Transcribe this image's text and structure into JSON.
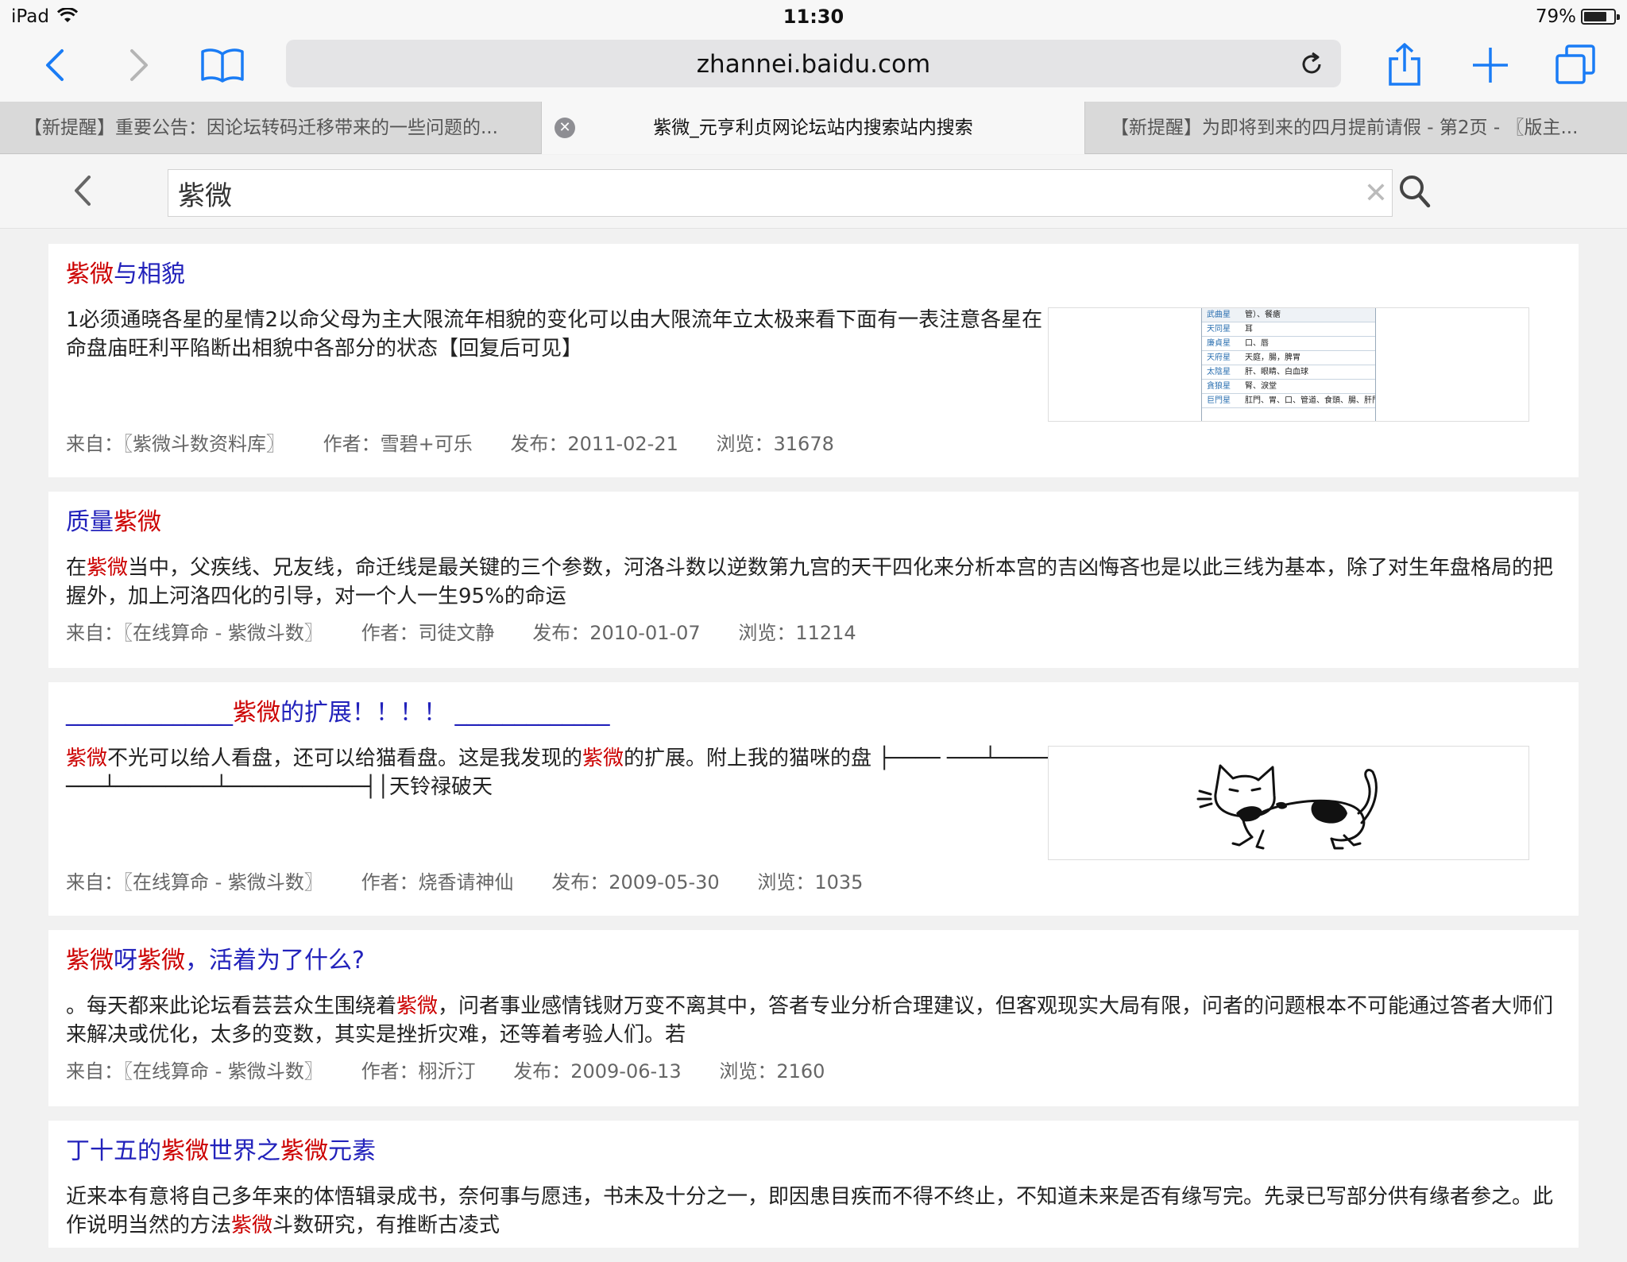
{
  "status": {
    "device": "iPad",
    "time": "11:30",
    "battery": "79%",
    "battery_level": 0.79
  },
  "browser": {
    "url": "zhannei.baidu.com",
    "tabs": [
      {
        "label": "【新提醒】重要公告：因论坛转码迁移带来的一些问题的..."
      },
      {
        "label": "紫微_元亨利贞网论坛站内搜索站内搜索",
        "active": true
      },
      {
        "label": "【新提醒】为即将到来的四月提前请假 - 第2页 - 〖版主..."
      }
    ]
  },
  "search": {
    "query": "紫微"
  },
  "results": [
    {
      "title": [
        {
          "t": "紫微",
          "hl": true
        },
        {
          "t": "与相貌",
          "hl": false
        }
      ],
      "body": [
        {
          "t": "1必须通晓各星的星情2以命父母为主大限流年相貌的变化可以由大限流年立太极来看下面有一表注意各星在命盘庙旺利平陷断出相貌中各部分的状态【回复后可见】",
          "hl": false
        }
      ],
      "source": "来自：〖紫微斗数资料库〗",
      "author": "作者：雪碧+可乐",
      "date": "发布：2011-02-21",
      "views": "浏览：31678",
      "thumbnail": {
        "rows": [
          {
            "star": "武曲星",
            "parts": "管）、餐瘡"
          },
          {
            "star": "天同星",
            "parts": "耳"
          },
          {
            "star": "廉貞星",
            "parts": "口、唇"
          },
          {
            "star": "天府星",
            "parts": "天庭，腸，脾胃"
          },
          {
            "star": "太陰星",
            "parts": "肝、眼睛、白血球"
          },
          {
            "star": "貪狼星",
            "parts": "腎、淚堂"
          },
          {
            "star": "巨門星",
            "parts": "肛門、胃、口、管道、食頭、腸、肝門"
          }
        ]
      }
    },
    {
      "title": [
        {
          "t": "质量",
          "hl": false
        },
        {
          "t": "紫微",
          "hl": true
        }
      ],
      "body": [
        {
          "t": "在",
          "hl": false
        },
        {
          "t": "紫微",
          "hl": true
        },
        {
          "t": "当中，父疾线、兄友线，命迁线是最关键的三个参数，河洛斗数以逆数第九宫的天干四化来分析本宫的吉凶悔吝也是以此三线为基本，除了对生年盘格局的把握外，加上河洛四化的引导，对一个人一生95%的命运",
          "hl": false
        }
      ],
      "source": "来自：〖在线算命 - 紫微斗数〗",
      "author": "作者：司徒文静",
      "date": "发布：2010-01-07",
      "views": "浏览：11214"
    },
    {
      "title": [
        {
          "t": "______________",
          "hl": false
        },
        {
          "t": "紫微",
          "hl": true
        },
        {
          "t": "的扩展！！！！ _____________",
          "hl": false
        }
      ],
      "body": [
        {
          "t": "紫微",
          "hl": true
        },
        {
          "t": "不光可以给人看盘，还可以给猫看盘。这是我发现的",
          "hl": false
        },
        {
          "t": "紫微",
          "hl": true
        },
        {
          "t": "的扩展。附上我的猫咪的盘 ├──── ───┴────────┴────────┴───────────┤│天铃禄破天",
          "hl": false
        }
      ],
      "source": "来自：〖在线算命 - 紫微斗数〗",
      "author": "作者：烧香请神仙",
      "date": "发布：2009-05-30",
      "views": "浏览：1035",
      "thumbnail": {
        "picture": "cat-drawing"
      }
    },
    {
      "title": [
        {
          "t": "紫微",
          "hl": true
        },
        {
          "t": "呀",
          "hl": false
        },
        {
          "t": "紫微",
          "hl": true
        },
        {
          "t": "，活着为了什么?",
          "hl": false
        }
      ],
      "body": [
        {
          "t": "。每天都来此论坛看芸芸众生围绕着",
          "hl": false
        },
        {
          "t": "紫微",
          "hl": true
        },
        {
          "t": "，问者事业感情钱财万变不离其中，答者专业分析合理建议，但客观现实大局有限，问者的问题根本不可能通过答者大师们来解决或优化，太多的变数，其实是挫折灾难，还等着考验人们。若",
          "hl": false
        }
      ],
      "source": "来自：〖在线算命 - 紫微斗数〗",
      "author": "作者：栩沂汀",
      "date": "发布：2009-06-13",
      "views": "浏览：2160"
    },
    {
      "title": [
        {
          "t": "丁十五的",
          "hl": false
        },
        {
          "t": "紫微",
          "hl": true
        },
        {
          "t": "世界之",
          "hl": false
        },
        {
          "t": "紫微",
          "hl": true
        },
        {
          "t": "元素",
          "hl": false
        }
      ],
      "body": [
        {
          "t": "近来本有意将自己多年来的体悟辑录成书，奈何事与愿违，书未及十分之一，即因患目疾而不得不终止，不知道未来是否有缘写完。先录已写部分供有缘者参之。此作说明当然的方法",
          "hl": false
        },
        {
          "t": "紫微",
          "hl": true
        },
        {
          "t": "斗数研究，有推断古凌式",
          "hl": false
        }
      ]
    }
  ]
}
